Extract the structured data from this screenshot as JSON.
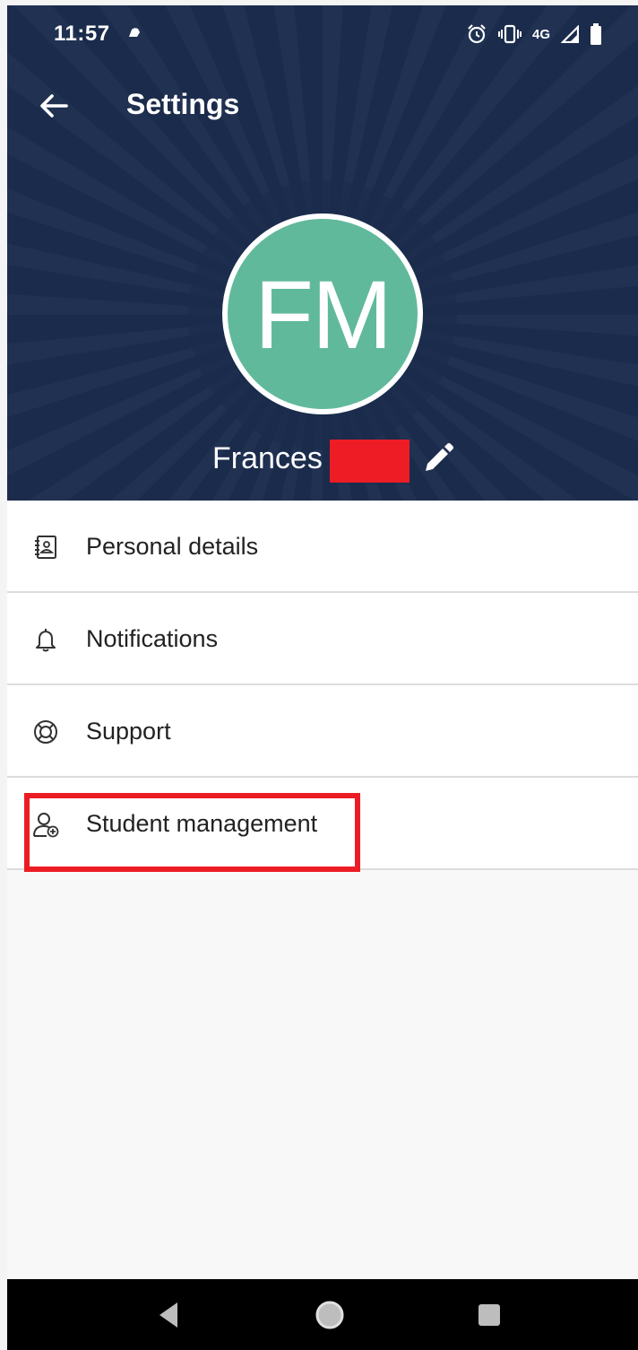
{
  "status_bar": {
    "time": "11:57",
    "network": "4G"
  },
  "toolbar": {
    "back_icon": "arrow-left-icon",
    "title": "Settings"
  },
  "profile": {
    "initials": "FM",
    "first_name": "Frances",
    "edit_icon": "pencil-icon",
    "avatar_color": "#61b99c"
  },
  "menu": {
    "items": [
      {
        "label": "Personal details",
        "icon": "contact-card-icon"
      },
      {
        "label": "Notifications",
        "icon": "bell-icon"
      },
      {
        "label": "Support",
        "icon": "lifebuoy-icon"
      },
      {
        "label": "Student management",
        "icon": "add-user-icon"
      }
    ]
  },
  "colors": {
    "header_bg": "#1b2b4b",
    "highlight": "#ec1c24",
    "list_bg": "#ffffff",
    "page_bg": "#f8f8f8"
  }
}
